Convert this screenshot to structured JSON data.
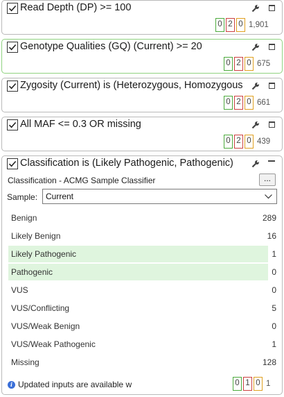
{
  "colors": {
    "green": "#4caa3c",
    "red": "#cc4040",
    "orange": "#e0a020",
    "highlight": "#dff5de",
    "active_border": "#8fd27f"
  },
  "filters": [
    {
      "title": "Read Depth (DP) >= 100",
      "checked": true,
      "counts": [
        "0",
        "2",
        "0"
      ],
      "total": "1,901"
    },
    {
      "title": "Genotype Qualities (GQ) (Current) >= 20",
      "checked": true,
      "counts": [
        "0",
        "2",
        "0"
      ],
      "total": "675"
    },
    {
      "title": "Zygosity (Current) is (Heterozygous, Homozygous",
      "checked": true,
      "counts": [
        "0",
        "2",
        "0"
      ],
      "total": "661"
    },
    {
      "title": "All MAF <= 0.3 OR missing",
      "checked": true,
      "counts": [
        "0",
        "2",
        "0"
      ],
      "total": "439"
    }
  ],
  "classification": {
    "title": "Classification is (Likely Pathogenic, Pathogenic)",
    "checked": true,
    "source": "Classification - ACMG Sample Classifier",
    "browse_label": "...",
    "sample_label": "Sample:",
    "sample_value": "Current",
    "rows": [
      {
        "label": "Benign",
        "value": "289"
      },
      {
        "label": "Likely Benign",
        "value": "16"
      },
      {
        "label": "Likely Pathogenic",
        "value": "1"
      },
      {
        "label": "Pathogenic",
        "value": "0"
      },
      {
        "label": "VUS",
        "value": "0"
      },
      {
        "label": "VUS/Conflicting",
        "value": "5"
      },
      {
        "label": "VUS/Weak Benign",
        "value": "0"
      },
      {
        "label": "VUS/Weak Pathogenic",
        "value": "1"
      },
      {
        "label": "Missing",
        "value": "128"
      }
    ],
    "info_text": "Updated inputs are available w",
    "counts": [
      "0",
      "1",
      "0"
    ],
    "total": "1"
  }
}
